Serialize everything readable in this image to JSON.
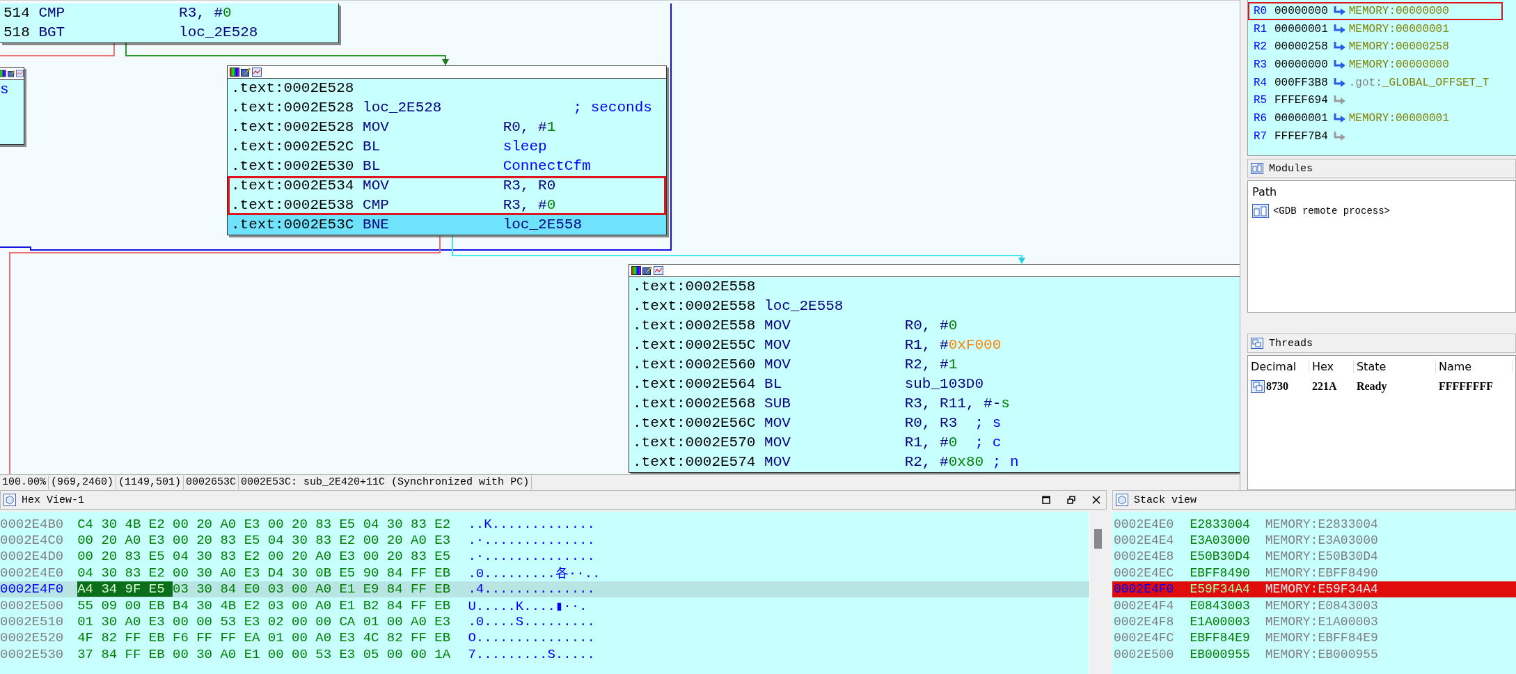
{
  "graph": {
    "nodes": [
      {
        "title_bar": false,
        "lines": [
          {
            "address": "514",
            "mnemonic": "CMP",
            "operands": [
              {
                "text": "R3, #",
                "kind": "plain"
              },
              {
                "text": "0",
                "kind": "num"
              }
            ],
            "selected": false,
            "boxed": false
          },
          {
            "address": "518",
            "mnemonic": "BGT",
            "operands": [
              {
                "text": "loc_2E528",
                "kind": "plain"
              }
            ],
            "selected": false,
            "boxed": false
          }
        ]
      },
      {
        "title_bar": true,
        "lines": [
          {
            "operands": [
              {
                "text": "s",
                "kind": "name"
              }
            ],
            "selected": false,
            "boxed": false
          }
        ]
      },
      {
        "title_bar": true,
        "lines": [
          {
            "address": ".text:0002E528",
            "selected": false,
            "boxed": false
          },
          {
            "address": ".text:0002E528",
            "mnemonic": "loc_2E528",
            "comment": "; seconds",
            "selected": false,
            "boxed": false
          },
          {
            "address": ".text:0002E528",
            "mnemonic": "MOV",
            "operands": [
              {
                "text": "R0, #",
                "kind": "plain"
              },
              {
                "text": "1",
                "kind": "num"
              }
            ],
            "selected": false,
            "boxed": false
          },
          {
            "address": ".text:0002E52C",
            "mnemonic": "BL",
            "operands": [
              {
                "text": "sleep",
                "kind": "name"
              }
            ],
            "selected": false,
            "boxed": false
          },
          {
            "address": ".text:0002E530",
            "mnemonic": "BL",
            "operands": [
              {
                "text": "ConnectCfm",
                "kind": "name"
              }
            ],
            "selected": false,
            "boxed": false
          },
          {
            "address": ".text:0002E534",
            "mnemonic": "MOV",
            "operands": [
              {
                "text": "R3, R0",
                "kind": "plain"
              }
            ],
            "selected": false,
            "boxed": true
          },
          {
            "address": ".text:0002E538",
            "mnemonic": "CMP",
            "operands": [
              {
                "text": "R3, #",
                "kind": "plain"
              },
              {
                "text": "0",
                "kind": "num"
              }
            ],
            "selected": false,
            "boxed": true
          },
          {
            "address": ".text:0002E53C",
            "mnemonic": "BNE",
            "operands": [
              {
                "text": "loc_2E558",
                "kind": "plain"
              }
            ],
            "selected": true,
            "boxed": false
          }
        ]
      },
      {
        "title_bar": true,
        "lines": [
          {
            "address": ".text:0002E558",
            "selected": false,
            "boxed": false
          },
          {
            "address": ".text:0002E558",
            "mnemonic": "loc_2E558",
            "selected": false,
            "boxed": false
          },
          {
            "address": ".text:0002E558",
            "mnemonic": "MOV",
            "operands": [
              {
                "text": "R0, #",
                "kind": "plain"
              },
              {
                "text": "0",
                "kind": "num"
              }
            ],
            "selected": false,
            "boxed": false
          },
          {
            "address": ".text:0002E55C",
            "mnemonic": "MOV",
            "operands": [
              {
                "text": "R1, #",
                "kind": "plain"
              },
              {
                "text": "0xF000",
                "kind": "hex"
              }
            ],
            "selected": false,
            "boxed": false
          },
          {
            "address": ".text:0002E560",
            "mnemonic": "MOV",
            "operands": [
              {
                "text": "R2, #",
                "kind": "plain"
              },
              {
                "text": "1",
                "kind": "num"
              }
            ],
            "selected": false,
            "boxed": false
          },
          {
            "address": ".text:0002E564",
            "mnemonic": "BL",
            "operands": [
              {
                "text": "sub_103D0",
                "kind": "plain"
              }
            ],
            "selected": false,
            "boxed": false
          },
          {
            "address": ".text:0002E568",
            "mnemonic": "SUB",
            "operands": [
              {
                "text": "R3, R11, #-",
                "kind": "plain"
              },
              {
                "text": "s",
                "kind": "num"
              }
            ],
            "selected": false,
            "boxed": false
          },
          {
            "address": ".text:0002E56C",
            "mnemonic": "MOV",
            "operands": [
              {
                "text": "R0, R3",
                "kind": "plain"
              }
            ],
            "comment": "; s",
            "selected": false,
            "boxed": false
          },
          {
            "address": ".text:0002E570",
            "mnemonic": "MOV",
            "operands": [
              {
                "text": "R1, #",
                "kind": "plain"
              },
              {
                "text": "0",
                "kind": "num"
              }
            ],
            "comment": "; c",
            "selected": false,
            "boxed": false
          },
          {
            "address": ".text:0002E574",
            "mnemonic": "MOV",
            "operands": [
              {
                "text": "R2, #",
                "kind": "plain"
              },
              {
                "text": "0x80",
                "kind": "num"
              }
            ],
            "comment": "; n",
            "selected": false,
            "boxed": false
          }
        ]
      }
    ]
  },
  "status_bar": [
    "100.00%",
    "(969,2460)",
    "(1149,501)",
    "0002653C",
    "0002E53C: sub_2E420+11C (Synchronized with PC)"
  ],
  "registers": [
    {
      "name": "R0",
      "value": "00000000",
      "target": "MEMORY:00000000",
      "boxed": true
    },
    {
      "name": "R1",
      "value": "00000001",
      "target": "MEMORY:00000001",
      "boxed": false
    },
    {
      "name": "R2",
      "value": "00000258",
      "target": "MEMORY:00000258",
      "boxed": false
    },
    {
      "name": "R3",
      "value": "00000000",
      "target": "MEMORY:00000000",
      "boxed": false
    },
    {
      "name": "R4",
      "value": "000FF3B8",
      "segment": ".got:",
      "target": "_GLOBAL_OFFSET_T",
      "boxed": false
    },
    {
      "name": "R5",
      "value": "FFFEF694",
      "boxed": false
    },
    {
      "name": "R6",
      "value": "00000001",
      "target": "MEMORY:00000001",
      "boxed": false
    },
    {
      "name": "R7",
      "value": "FFFEF7B4",
      "boxed": false
    }
  ],
  "modules": {
    "title": "Modules",
    "columns": [
      "Path"
    ],
    "rows": [
      "<GDB remote process>"
    ]
  },
  "threads": {
    "title": "Threads",
    "columns": [
      "Decimal",
      "Hex",
      "State",
      "Name"
    ],
    "rows": [
      [
        "8730",
        "221A",
        "Ready",
        "FFFFFFFF"
      ]
    ]
  },
  "hex_view": {
    "title": "Hex View-1",
    "rows": [
      {
        "address": "0002E4B0",
        "bytes": [
          "C4",
          "30",
          "4B",
          "E2",
          "00",
          "20",
          "A0",
          "E3",
          "00",
          "20",
          "83",
          "E5",
          "04",
          "30",
          "83",
          "E2"
        ],
        "ascii": "..K.............",
        "selected": false
      },
      {
        "address": "0002E4C0",
        "bytes": [
          "00",
          "20",
          "A0",
          "E3",
          "00",
          "20",
          "83",
          "E5",
          "04",
          "30",
          "83",
          "E2",
          "00",
          "20",
          "A0",
          "E3"
        ],
        "ascii": ".·..............",
        "selected": false
      },
      {
        "address": "0002E4D0",
        "bytes": [
          "00",
          "20",
          "83",
          "E5",
          "04",
          "30",
          "83",
          "E2",
          "00",
          "20",
          "A0",
          "E3",
          "00",
          "20",
          "83",
          "E5"
        ],
        "ascii": ".·..............",
        "selected": false
      },
      {
        "address": "0002E4E0",
        "bytes": [
          "04",
          "30",
          "83",
          "E2",
          "00",
          "30",
          "A0",
          "E3",
          "D4",
          "30",
          "0B",
          "E5",
          "90",
          "84",
          "FF",
          "EB"
        ],
        "ascii": ".0.........各··..",
        "selected": false
      },
      {
        "address": "0002E4F0",
        "marked_bytes": [
          "A4",
          "34",
          "9F",
          "E5"
        ],
        "bytes": [
          "03",
          "30",
          "84",
          "E0",
          "03",
          "00",
          "A0",
          "E1",
          "E9",
          "84",
          "FF",
          "EB"
        ],
        "ascii": ".4..............",
        "selected": true
      },
      {
        "address": "0002E500",
        "bytes": [
          "55",
          "09",
          "00",
          "EB",
          "B4",
          "30",
          "4B",
          "E2",
          "03",
          "00",
          "A0",
          "E1",
          "B2",
          "84",
          "FF",
          "EB"
        ],
        "ascii": "U.....K....▮··.",
        "selected": false
      },
      {
        "address": "0002E510",
        "bytes": [
          "01",
          "30",
          "A0",
          "E3",
          "00",
          "00",
          "53",
          "E3",
          "02",
          "00",
          "00",
          "CA",
          "01",
          "00",
          "A0",
          "E3"
        ],
        "ascii": ".0....S.........",
        "selected": false
      },
      {
        "address": "0002E520",
        "bytes": [
          "4F",
          "82",
          "FF",
          "EB",
          "F6",
          "FF",
          "FF",
          "EA",
          "01",
          "00",
          "A0",
          "E3",
          "4C",
          "82",
          "FF",
          "EB"
        ],
        "ascii": "O...............",
        "selected": false
      },
      {
        "address": "0002E530",
        "bytes": [
          "37",
          "84",
          "FF",
          "EB",
          "00",
          "30",
          "A0",
          "E1",
          "00",
          "00",
          "53",
          "E3",
          "05",
          "00",
          "00",
          "1A"
        ],
        "ascii": "7.........S.....",
        "selected": false
      }
    ]
  },
  "stack_view": {
    "title": "Stack view",
    "rows": [
      {
        "address": "0002E4E0",
        "value": "E2833004",
        "target": "MEMORY:E2833004",
        "selected": false
      },
      {
        "address": "0002E4E4",
        "value": "E3A03000",
        "target": "MEMORY:E3A03000",
        "selected": false
      },
      {
        "address": "0002E4E8",
        "value": "E50B30D4",
        "target": "MEMORY:E50B30D4",
        "selected": false
      },
      {
        "address": "0002E4EC",
        "value": "EBFF8490",
        "target": "MEMORY:EBFF8490",
        "selected": false
      },
      {
        "address": "0002E4F0",
        "value": "E59F34A4",
        "target": "MEMORY:E59F34A4",
        "selected": true
      },
      {
        "address": "0002E4F4",
        "value": "E0843003",
        "target": "MEMORY:E0843003",
        "selected": false
      },
      {
        "address": "0002E4F8",
        "value": "E1A00003",
        "target": "MEMORY:E1A00003",
        "selected": false
      },
      {
        "address": "0002E4FC",
        "value": "EBFF84E9",
        "target": "MEMORY:EBFF84E9",
        "selected": false
      },
      {
        "address": "0002E500",
        "value": "EB000955",
        "target": "MEMORY:EB000955",
        "selected": false
      }
    ]
  }
}
